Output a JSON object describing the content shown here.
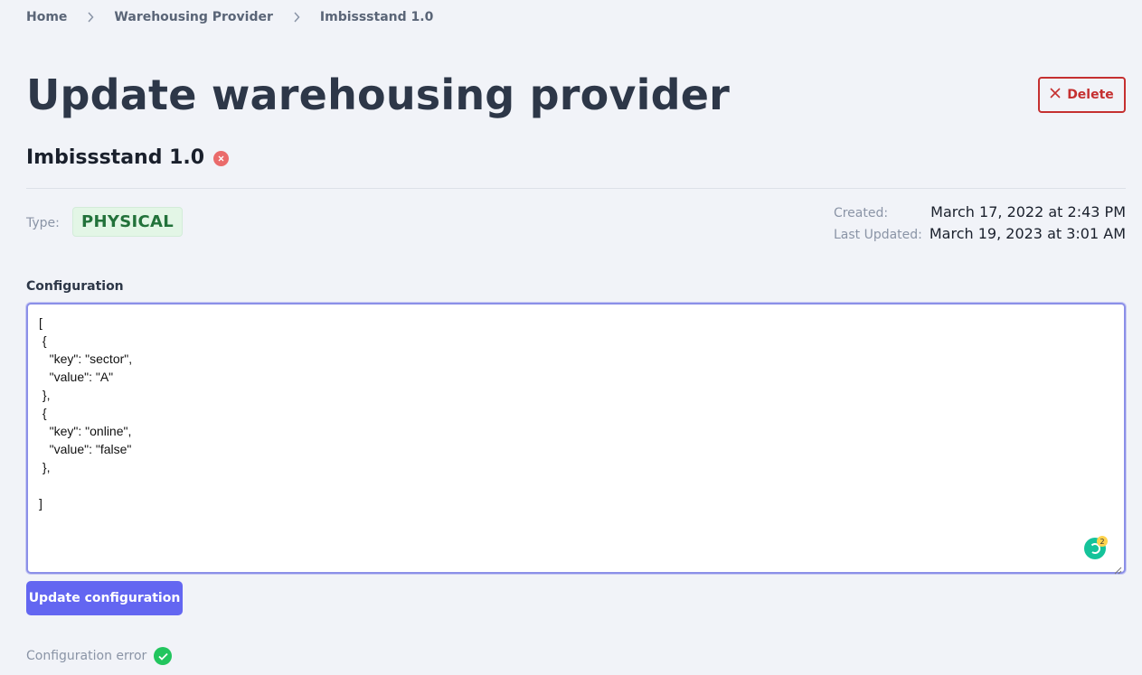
{
  "breadcrumb": {
    "items": [
      "Home",
      "Warehousing Provider",
      "Imbissstand 1.0"
    ]
  },
  "header": {
    "title": "Update warehousing provider",
    "delete_label": "Delete"
  },
  "provider": {
    "name": "Imbissstand 1.0",
    "status_icon": "x-circle-icon",
    "status_color": "#ea6b6b",
    "type_label": "Type:",
    "type_value": "PHYSICAL",
    "created_label": "Created:",
    "created_value": "March 17, 2022 at 2:43 PM",
    "updated_label": "Last Updated:",
    "updated_value": "March 19, 2023 at 3:01 AM"
  },
  "configuration": {
    "label": "Configuration",
    "value": "[\n {\n   \"key\": \"sector\",\n   \"value\": \"A\"\n },\n {\n   \"key\": \"online\",\n   \"value\": \"false\"\n },\n\n]",
    "assist_badge_count": "2",
    "update_label": "Update configuration",
    "error_label": "Configuration error",
    "error_status_icon": "check-circle-icon"
  },
  "colors": {
    "accent": "#6366f1",
    "danger": "#c53030",
    "success": "#22c55e",
    "badge_bg": "#e3f6e6",
    "badge_text": "#22723a"
  }
}
